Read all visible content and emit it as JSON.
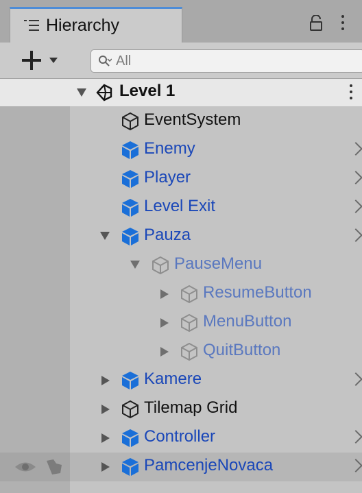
{
  "panel": {
    "tab_label": "Hierarchy",
    "tab_icon": "hierarchy-list-icon",
    "lock_icon": "lock-icon",
    "menu_icon": "vertical-ellipsis-icon"
  },
  "toolbar": {
    "add_icon": "plus-icon",
    "search_placeholder": "All"
  },
  "scene": {
    "name": "Level 1",
    "icon": "unity-scene-icon"
  },
  "colors": {
    "prefab_blue": "#1a6fd8",
    "prefab_label": "#1a47b8",
    "accent": "#4d8cd7"
  },
  "items": [
    {
      "label": "EventSystem",
      "type": "gameobject",
      "fold": "none",
      "depth": 1,
      "chevron": false
    },
    {
      "label": "Enemy",
      "type": "prefab",
      "fold": "none",
      "depth": 1,
      "chevron": true
    },
    {
      "label": "Player",
      "type": "prefab",
      "fold": "none",
      "depth": 1,
      "chevron": true
    },
    {
      "label": "Level Exit",
      "type": "prefab",
      "fold": "none",
      "depth": 1,
      "chevron": true
    },
    {
      "label": "Pauza",
      "type": "prefab",
      "fold": "open",
      "depth": 1,
      "chevron": true
    },
    {
      "label": "PauseMenu",
      "type": "inactive",
      "fold": "open",
      "depth": 2,
      "chevron": false
    },
    {
      "label": "ResumeButton",
      "type": "inactive",
      "fold": "closed",
      "depth": 3,
      "chevron": false
    },
    {
      "label": "MenuButton",
      "type": "inactive",
      "fold": "closed",
      "depth": 3,
      "chevron": false
    },
    {
      "label": "QuitButton",
      "type": "inactive",
      "fold": "closed",
      "depth": 3,
      "chevron": false
    },
    {
      "label": "Kamere",
      "type": "prefab",
      "fold": "closed",
      "depth": 1,
      "chevron": true
    },
    {
      "label": "Tilemap Grid",
      "type": "gameobject",
      "fold": "closed",
      "depth": 1,
      "chevron": false
    },
    {
      "label": "Controller",
      "type": "prefab",
      "fold": "closed",
      "depth": 1,
      "chevron": true
    },
    {
      "label": "PamcenjeNovaca",
      "type": "prefab",
      "fold": "closed",
      "depth": 1,
      "chevron": true,
      "hovered": true
    }
  ]
}
